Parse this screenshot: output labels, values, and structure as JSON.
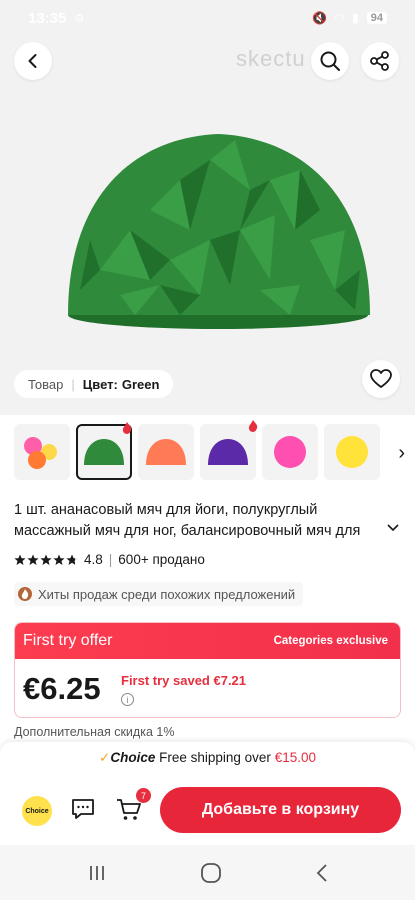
{
  "status_bar": {
    "time": "13:35",
    "battery": "94"
  },
  "hero": {
    "watermark": "skectu",
    "product_color": "#2f8a3b",
    "color_label": "Товар",
    "color_value_prefix": "Цвет:",
    "color_value": "Green"
  },
  "icons": {
    "back": "chevron-left-icon",
    "search": "search-icon",
    "share": "share-icon",
    "favorite": "heart-icon"
  },
  "thumbnails": [
    {
      "name": "mixed-colors",
      "hot": false,
      "selected": false
    },
    {
      "name": "green",
      "hot": true,
      "selected": true
    },
    {
      "name": "orange",
      "hot": false,
      "selected": false
    },
    {
      "name": "purple",
      "hot": true,
      "selected": false
    },
    {
      "name": "pink",
      "hot": false,
      "selected": false
    },
    {
      "name": "yellow",
      "hot": false,
      "selected": false
    }
  ],
  "product": {
    "title": "1 шт. ананасовый мяч для йоги, полукруглый массажный мяч для ног, балансировочный мяч для",
    "rating": "4.8",
    "sold": "600+ продано",
    "hits_label": "Хиты продаж среди похожих предложений"
  },
  "offer": {
    "title": "First try offer",
    "badge": "Categories exclusive",
    "price": "€6.25",
    "saved": "First try saved €7.21",
    "info": "i"
  },
  "extra_discount": "Дополнительная скидка 1%",
  "bottom": {
    "choice_mark": "✓",
    "choice_label": "Choice",
    "shipping_text": "Free shipping over",
    "shipping_amount": "€15.00",
    "choice_badge": "Choice",
    "cart_count": "7",
    "add_to_cart": "Добавьте в корзину"
  },
  "colors": {
    "accent": "#e8263a",
    "offer_red": "#fd3c4f",
    "choice_yellow": "#ffe14d"
  }
}
